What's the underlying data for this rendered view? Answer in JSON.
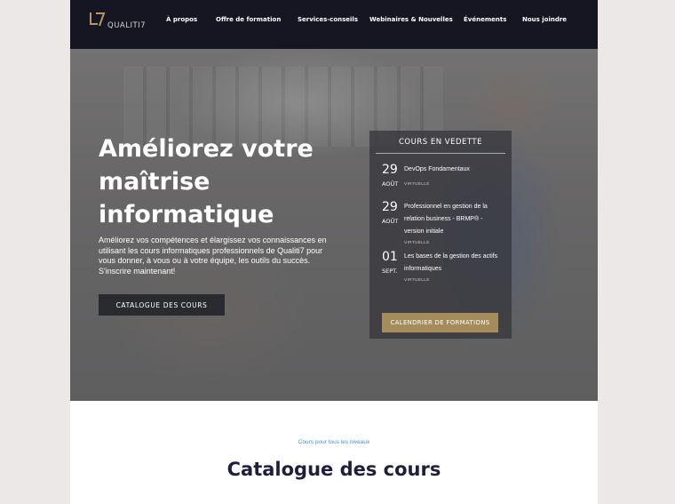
{
  "header": {
    "logo_text": "QUALITI7",
    "nav": [
      "À propos",
      "Offre de formation",
      "Services-conseils",
      "Webinaires & Nouvelles",
      "Événements",
      "Nous joindre"
    ]
  },
  "hero": {
    "title": "Améliorez votre maîtrise informatique",
    "text": "Améliorez vos compétences et élargissez vos connaissances en utilisant les cours informatiques professionnels de Qualiti7 pour vous donner, à vous ou à votre équipe, les outils du succès. S'inscrire maintenant!",
    "button_label": "CATALOGUE DES COURS"
  },
  "featured": {
    "title": "COURS EN VEDETTE",
    "courses": [
      {
        "day": "29",
        "month": "AOÛT",
        "name": "DevOps Fondamentaux",
        "mode": "VIRTUELLE"
      },
      {
        "day": "29",
        "month": "AOÛT",
        "name": "Professionnel en gestion de la relation business - BRMP® - version initiale",
        "mode": "VIRTUELLE"
      },
      {
        "day": "01",
        "month": "SEPT.",
        "name": "Les bases de la gestion des actifs informatiques",
        "mode": "VIRTUELLE"
      }
    ],
    "button_label": "CALENDRIER DE FORMATIONS"
  },
  "catalog_section": {
    "kicker": "Cours pour tous les niveaux",
    "title": "Catalogue des cours"
  },
  "colors": {
    "header_bg": "#151622",
    "accent_gold": "#a58d5b",
    "link_blue": "#4a8bd6",
    "title_navy": "#1d1f3f"
  }
}
